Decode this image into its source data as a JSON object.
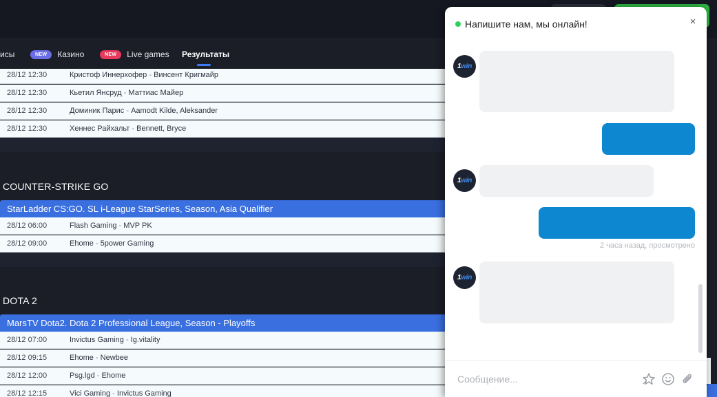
{
  "nav": {
    "items": [
      {
        "label": "исы",
        "badge": null
      },
      {
        "label": "Казино",
        "badge": "NEW",
        "badge_color": "#6b6de6"
      },
      {
        "label": "Live games",
        "badge": "NEW",
        "badge_color": "#e8385b"
      },
      {
        "label": "Результаты",
        "badge": null,
        "active": true
      }
    ]
  },
  "results": {
    "top_rows": [
      {
        "time": "28/12 12:30",
        "team1": "Кристоф Иннерхофер",
        "team2": "Винсент Кригмайр"
      },
      {
        "time": "28/12 12:30",
        "team1": "Кьетил Янсруд",
        "team2": "Маттиас Майер"
      },
      {
        "time": "28/12 12:30",
        "team1": "Доминик Парис",
        "team2": "Aamodt Kilde, Aleksander"
      },
      {
        "time": "28/12 12:30",
        "team1": "Хеннес Райхальт",
        "team2": "Bennett, Bryce"
      }
    ],
    "sections": [
      {
        "title": "COUNTER-STRIKE GO",
        "league": "StarLadder CS:GO. SL i-League StarSeries, Season, Asia Qualifier",
        "rows": [
          {
            "time": "28/12 06:00",
            "team1": "Flash Gaming",
            "team2": "MVP PK"
          },
          {
            "time": "28/12 09:00",
            "team1": "Ehome",
            "team2": "5power Gaming"
          }
        ]
      },
      {
        "title": "DOTA 2",
        "league": "MarsTV Dota2. Dota 2 Professional League, Season - Playoffs",
        "rows": [
          {
            "time": "28/12 07:00",
            "team1": "Invictus Gaming",
            "team2": "Ig.vitality"
          },
          {
            "time": "28/12 09:15",
            "team1": "Ehome",
            "team2": "Newbee"
          },
          {
            "time": "28/12 12:00",
            "team1": "Psg.lgd",
            "team2": "Ehome"
          },
          {
            "time": "28/12 12:15",
            "team1": "Vici Gaming",
            "team2": "Invictus Gaming"
          }
        ]
      }
    ],
    "separator": "-"
  },
  "chat": {
    "title": "Напишите нам, мы онлайн!",
    "close_glyph": "×",
    "avatar_text_prefix": "1",
    "avatar_text_suffix": "win",
    "read_status": "2 часа назад, просмотрено",
    "input_placeholder": "Сообщение...",
    "icons": [
      "rating-icon",
      "emoji-icon",
      "attach-icon"
    ],
    "colors": {
      "online": "#2fd15c",
      "outgoing": "#0d87cf",
      "incoming": "#f0f1f3"
    }
  },
  "colors": {
    "league_bar": "#3a6fe0",
    "background": "#1b1e27",
    "header": "#151821",
    "register_button": "#2fb344"
  }
}
